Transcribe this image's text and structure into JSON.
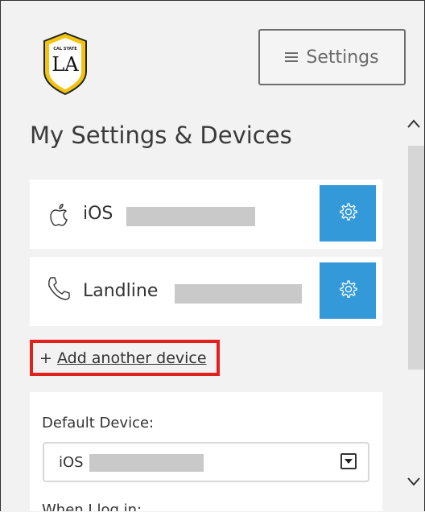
{
  "logo": {
    "small_text": "CAL STATE",
    "big_text": "LA"
  },
  "header": {
    "settings_label": "Settings",
    "menu_icon": "hamburger-icon"
  },
  "page_title": "My Settings & Devices",
  "devices": [
    {
      "name": "iOS",
      "icon": "apple-icon",
      "action_icon": "gear-icon"
    },
    {
      "name": "Landline",
      "icon": "phone-icon",
      "action_icon": "gear-icon"
    }
  ],
  "add_device": {
    "prefix": "+ ",
    "label": "Add another device"
  },
  "default_device": {
    "label": "Default Device:",
    "selected": "iOS"
  },
  "when_login": {
    "label": "When I log in:"
  },
  "colors": {
    "accent": "#3399d8",
    "highlight": "#e3201b",
    "logo_gold": "#f1c40f"
  }
}
